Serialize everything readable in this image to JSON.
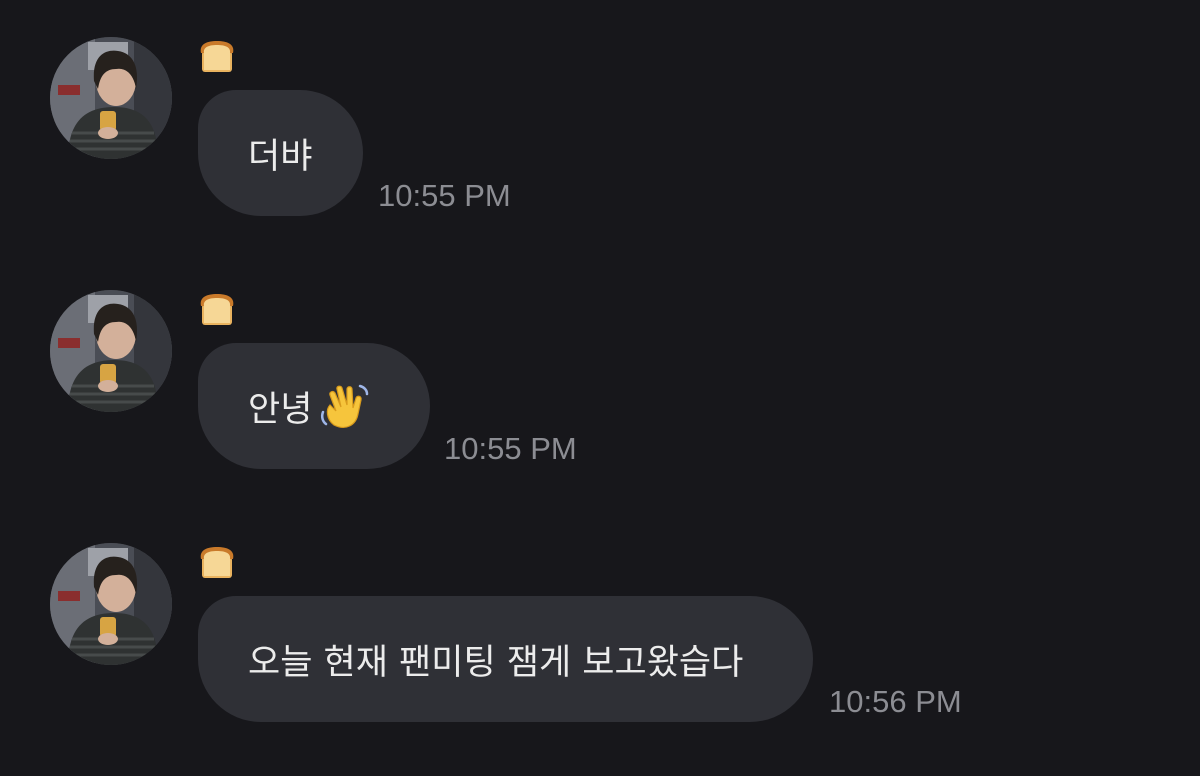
{
  "sender": {
    "name_icon": "bread-emoji-icon",
    "avatar_icon": "profile-photo-avatar"
  },
  "messages": [
    {
      "text": "더뱌",
      "emoji": "",
      "time": "10:55 PM"
    },
    {
      "text": "안녕",
      "emoji": "waving-hand-emoji-icon",
      "time": "10:55 PM"
    },
    {
      "text": "오늘 현재 팬미팅 잼게 보고왔습다",
      "emoji": "",
      "time": "10:56 PM"
    }
  ],
  "colors": {
    "background": "#17171b",
    "bubble": "#2f3036",
    "message_text": "#ececec",
    "timestamp": "#8c8d93"
  }
}
